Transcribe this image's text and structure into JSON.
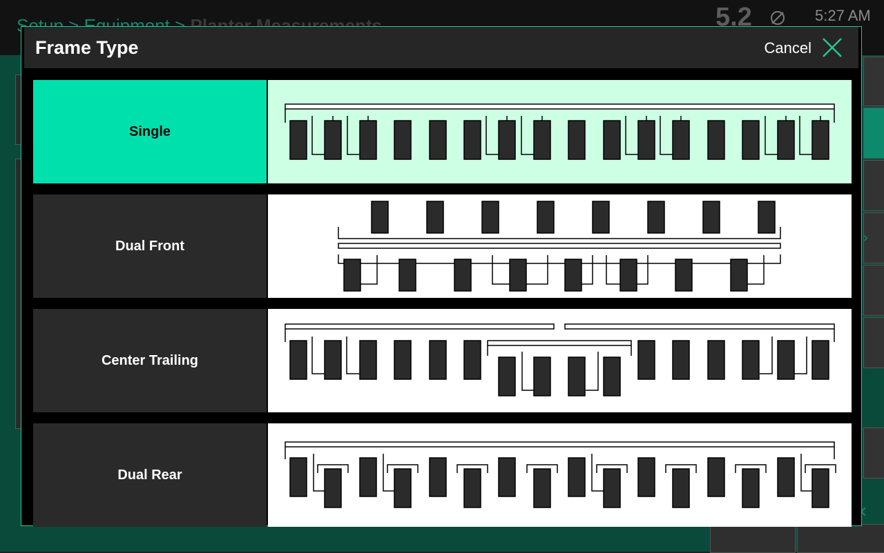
{
  "background": {
    "breadcrumb_parent": "Setup > Equipment >",
    "breadcrumb_current": "Planter Measurements",
    "speed": "5.2",
    "time": "5:27 AM"
  },
  "modal": {
    "title": "Frame Type",
    "cancel_label": "Cancel",
    "options": [
      {
        "label": "Single",
        "selected": true
      },
      {
        "label": "Dual Front",
        "selected": false
      },
      {
        "label": "Center Trailing",
        "selected": false
      },
      {
        "label": "Dual Rear",
        "selected": false
      }
    ]
  },
  "colors": {
    "accent": "#00e0ad",
    "selected_diagram_bg": "#ccffe4",
    "row_unit": "#2b2b2b"
  }
}
